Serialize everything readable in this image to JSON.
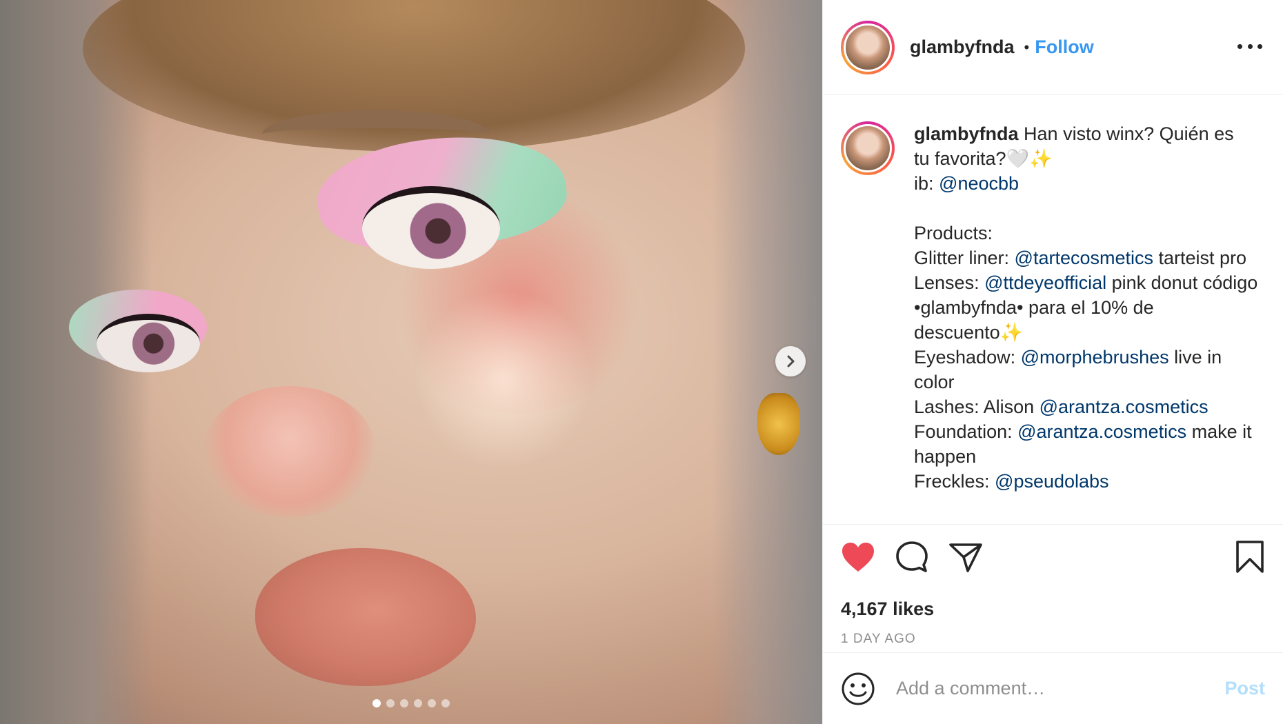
{
  "post": {
    "username": "glambyfnda",
    "separator": "•",
    "follow_label": "Follow",
    "carousel": {
      "dot_count": 6,
      "active_index": 0
    }
  },
  "caption": {
    "username": "glambyfnda",
    "line1_text": " Han visto winx? Quién es",
    "line2_text": "tu favorita?🤍✨",
    "ib_label": "ib: ",
    "ib_mention": "@neocbb",
    "products_label": "Products:",
    "glitter_label": "Glitter liner: ",
    "glitter_mention": "@tartecosmetics",
    "glitter_rest": " tarteist pro",
    "lenses_label": "Lenses: ",
    "lenses_mention": "@ttdeyeofficial",
    "lenses_rest": " pink donut código •glambyfnda• para el 10% de descuento✨",
    "eyeshadow_label": "Eyeshadow: ",
    "eyeshadow_mention": "@morphebrushes",
    "eyeshadow_rest": " live in color",
    "lashes_label": "Lashes: Alison ",
    "lashes_mention": "@arantza.cosmetics",
    "foundation_label": "Foundation: ",
    "foundation_mention": "@arantza.cosmetics",
    "foundation_rest": " make it happen",
    "freckles_label": "Freckles: ",
    "freckles_mention": "@pseudolabs"
  },
  "engagement": {
    "likes": "4,167 likes",
    "timestamp": "1 DAY AGO",
    "liked": true
  },
  "comment": {
    "placeholder": "Add a comment…",
    "post_label": "Post"
  },
  "icons": {
    "heart": "heart-icon",
    "comment": "comment-icon",
    "share": "share-icon",
    "bookmark": "bookmark-icon",
    "emoji": "emoji-icon",
    "more": "more-icon",
    "next": "chevron-right-icon"
  },
  "colors": {
    "link": "#3897f0",
    "mention": "#00376b",
    "like": "#ed4956",
    "post_disabled": "#b2dffc",
    "muted": "#8e8e8e"
  }
}
